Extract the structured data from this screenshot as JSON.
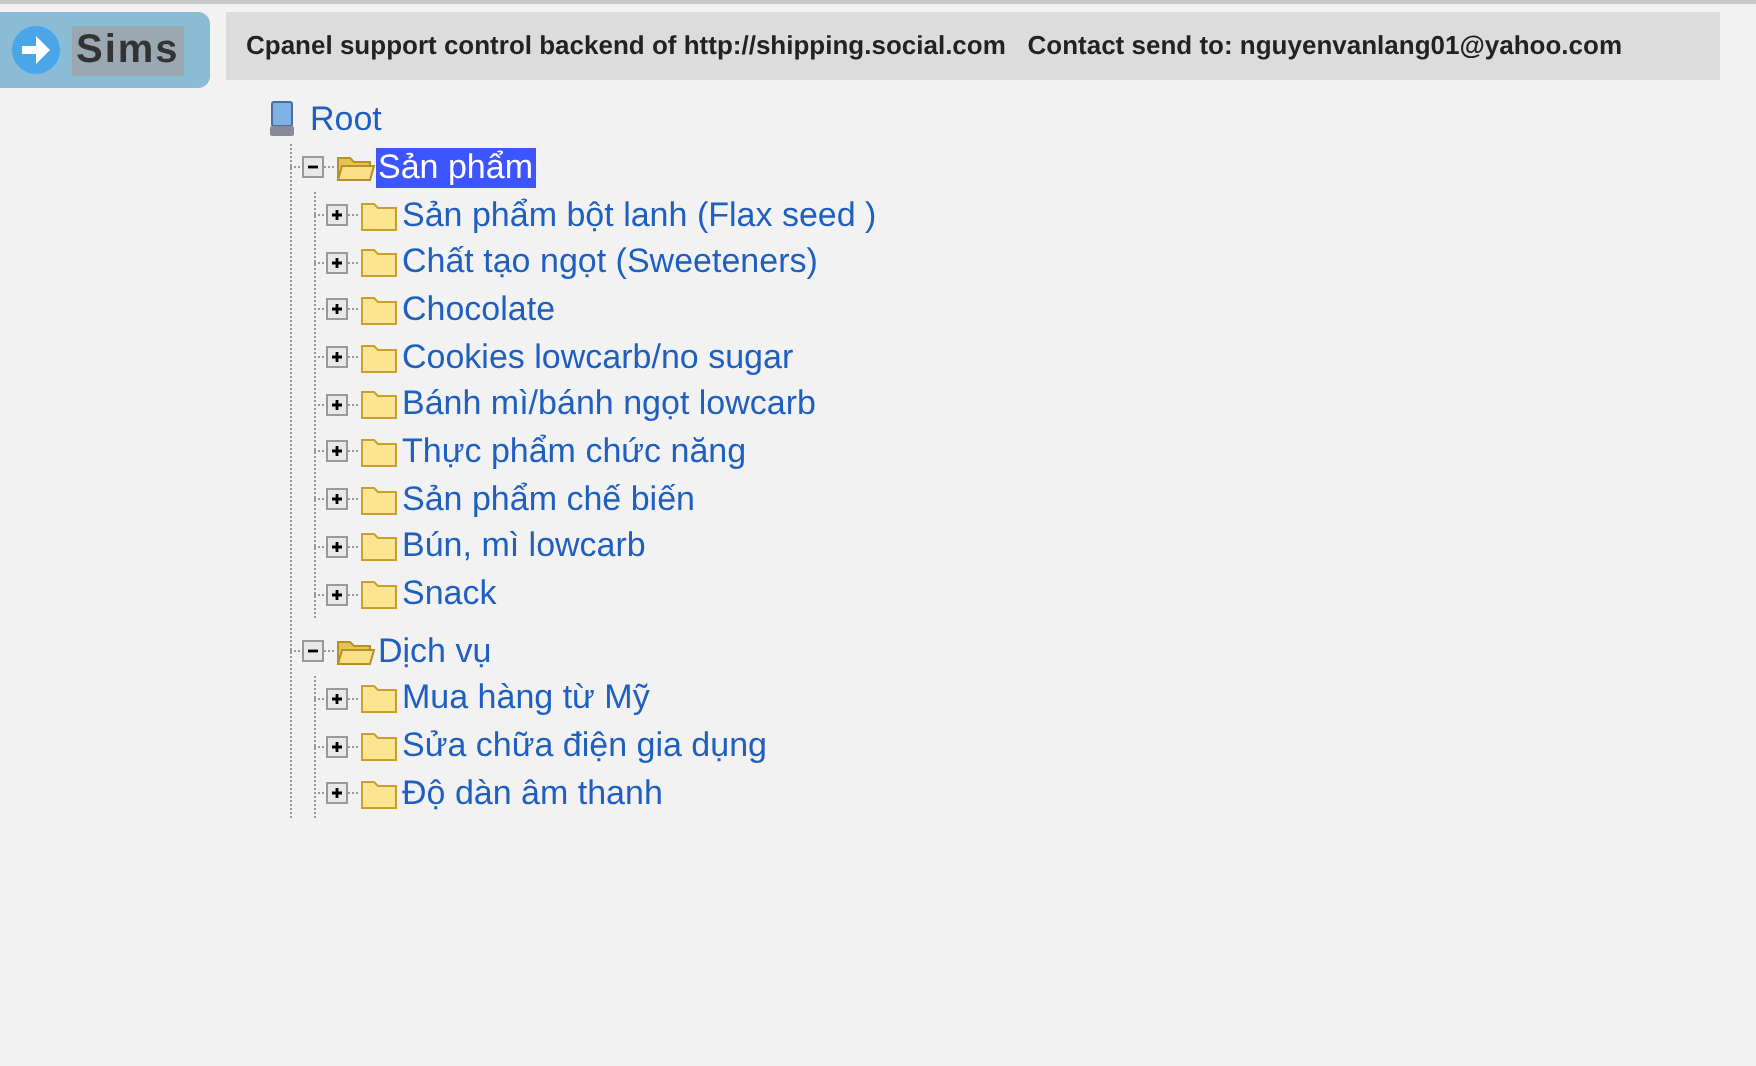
{
  "logo": {
    "label": "Sims"
  },
  "header": {
    "text": "Cpanel support control backend of http://shipping.social.com   Contact send to: nguyenvanlang01@yahoo.com"
  },
  "tree": {
    "label": "Root",
    "children": [
      {
        "label": "Sản phẩm",
        "expanded": true,
        "selected": true,
        "children": [
          {
            "label": "Sản phẩm bột lanh (Flax seed )",
            "expanded": false,
            "selected": false
          },
          {
            "label": "Chất tạo ngọt (Sweeteners)",
            "expanded": false,
            "selected": false
          },
          {
            "label": "Chocolate",
            "expanded": false,
            "selected": false
          },
          {
            "label": "Cookies lowcarb/no sugar",
            "expanded": false,
            "selected": false
          },
          {
            "label": "Bánh mì/bánh ngọt lowcarb",
            "expanded": false,
            "selected": false
          },
          {
            "label": "Thực phẩm chức năng",
            "expanded": false,
            "selected": false
          },
          {
            "label": "Sản phẩm chế biến",
            "expanded": false,
            "selected": false
          },
          {
            "label": "Bún, mì lowcarb",
            "expanded": false,
            "selected": false
          },
          {
            "label": "Snack",
            "expanded": false,
            "selected": false
          }
        ]
      },
      {
        "label": "Dịch vụ",
        "expanded": true,
        "selected": false,
        "children": [
          {
            "label": "Mua hàng từ Mỹ",
            "expanded": false,
            "selected": false
          },
          {
            "label": "Sửa chữa điện gia dụng",
            "expanded": false,
            "selected": false
          },
          {
            "label": "Độ dàn âm thanh",
            "expanded": false,
            "selected": false
          }
        ]
      }
    ]
  }
}
